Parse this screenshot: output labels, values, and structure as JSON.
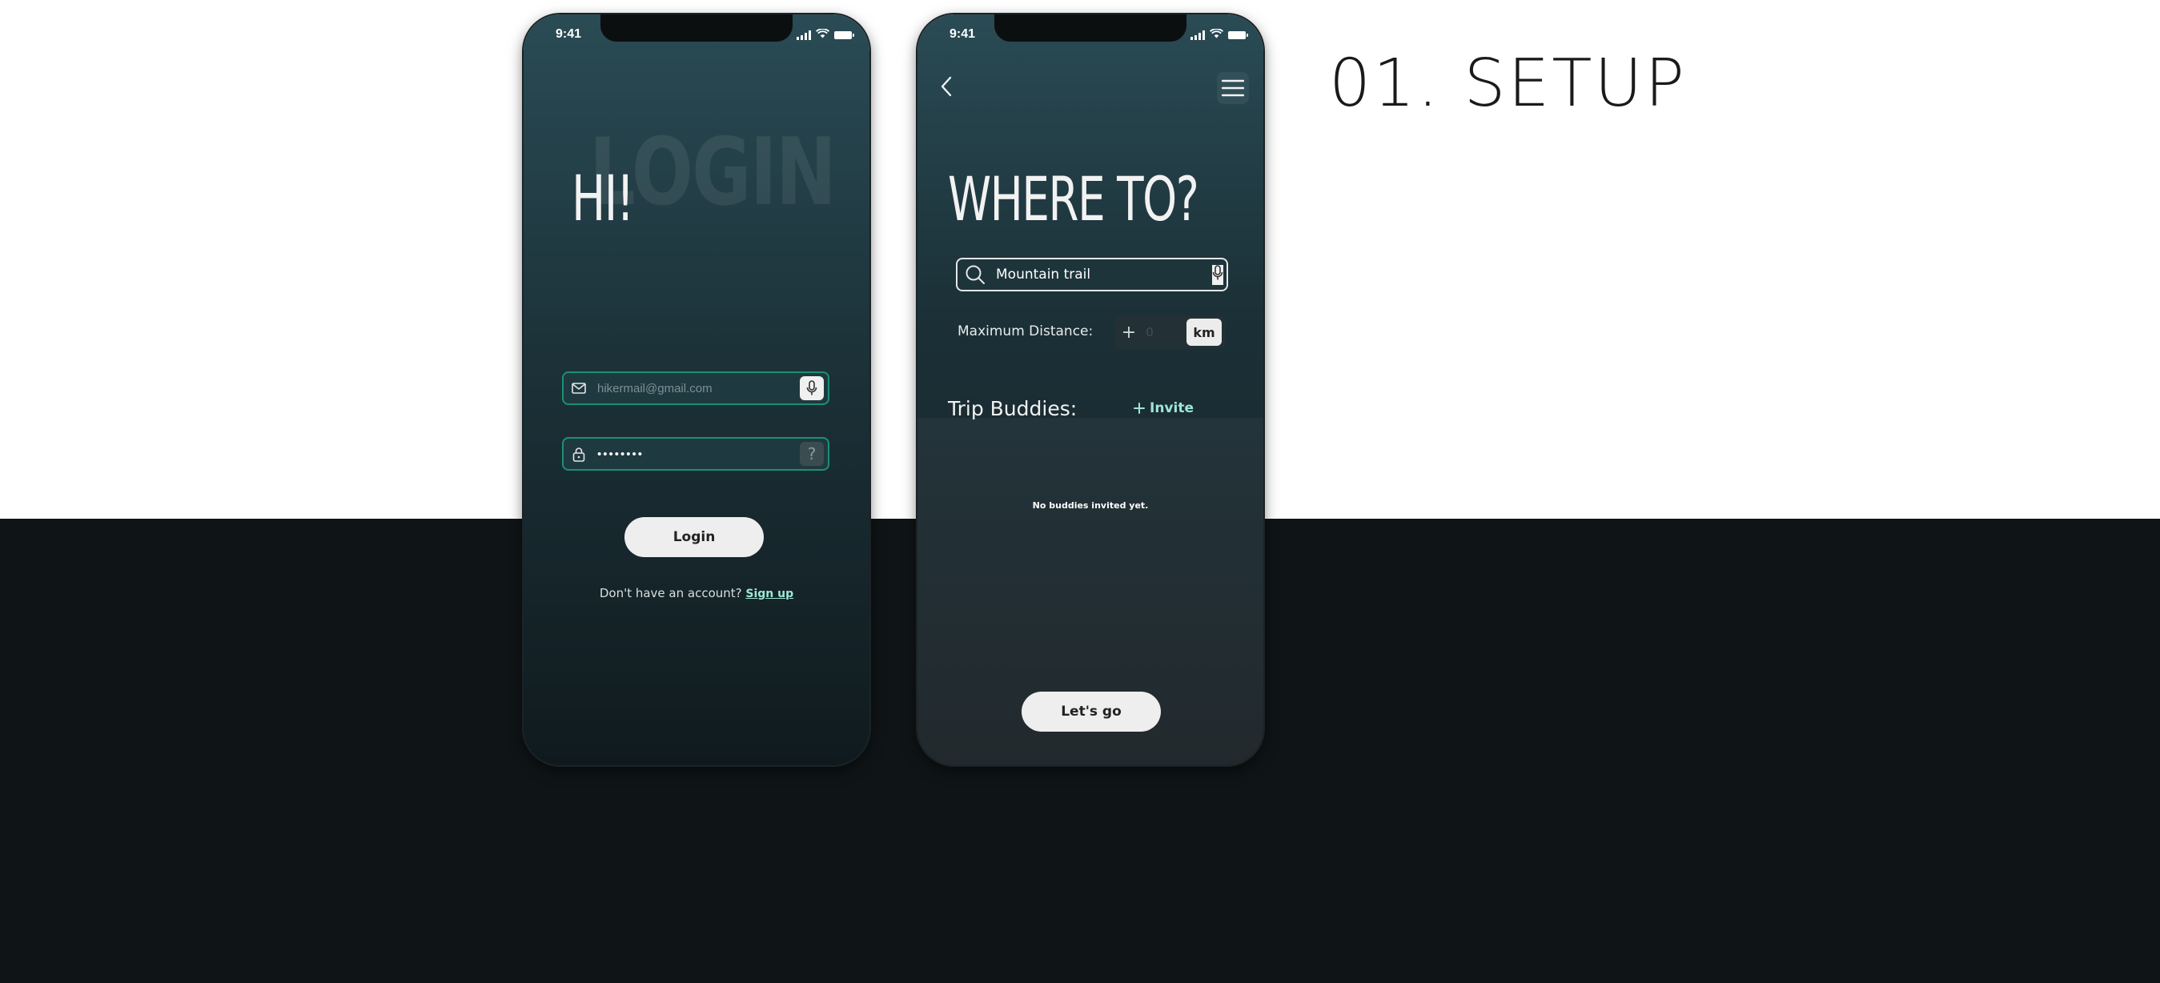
{
  "page": {
    "section_title": "01. SETUP"
  },
  "status_bar": {
    "time": "9:41"
  },
  "login": {
    "ghost_word": "LOGIN",
    "title": "HI!",
    "email": {
      "placeholder": "hikermail@gmail.com",
      "value": ""
    },
    "password": {
      "value": "••••••••",
      "help_label": "?"
    },
    "login_button": "Login",
    "signup_prompt": "Don't have an account?",
    "signup_link": "Sign up"
  },
  "setup": {
    "title": "WHERE TO?",
    "search": {
      "value": "Mountain trail"
    },
    "distance": {
      "label": "Maximum Distance:",
      "increment_label": "+",
      "value": "0",
      "unit": "km"
    },
    "buddies": {
      "title": "Trip Buddies:",
      "invite_label": "Invite",
      "empty_message": "No buddies invited yet."
    },
    "go_button": "Let's go"
  },
  "colors": {
    "accent_green": "#1d8f74",
    "link_mint": "#9ee6d6",
    "dark_background": "#0f1416"
  },
  "icons": [
    "signal-icon",
    "wifi-icon",
    "battery-icon",
    "mail-icon",
    "microphone-icon",
    "lock-icon",
    "help-icon",
    "back-chevron-icon",
    "menu-icon",
    "search-icon",
    "plus-icon"
  ]
}
